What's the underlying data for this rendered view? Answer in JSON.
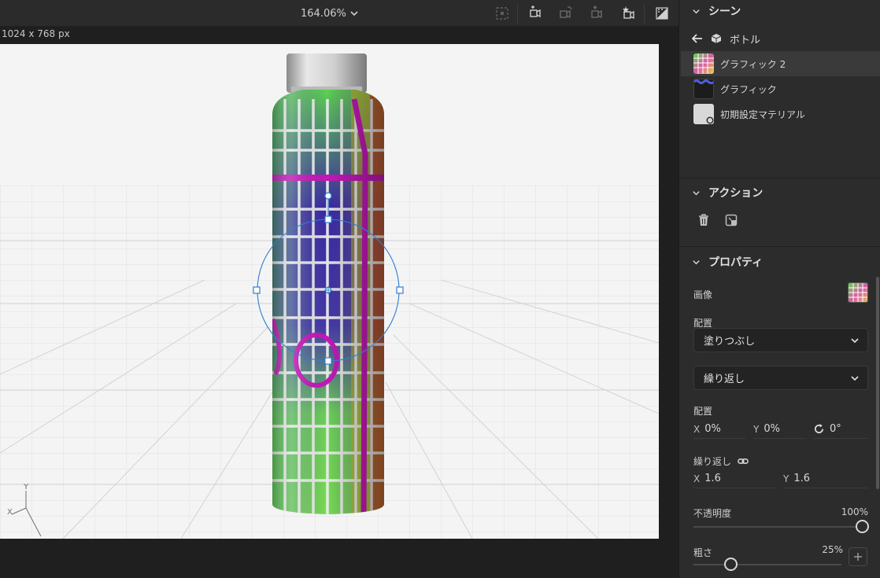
{
  "toolbar": {
    "zoom": "164.06%",
    "icons": [
      "frame-icon",
      "camera-bookmark-icon",
      "camera-rotate-icon",
      "camera-move-icon",
      "camera-favorite-icon",
      "render-preview-icon"
    ]
  },
  "viewport": {
    "size_label": "1024 x 768 px",
    "axis_y": "Y",
    "axis_x": "X"
  },
  "panel": {
    "scene": {
      "title": "シーン",
      "breadcrumb": "ボトル",
      "layers": [
        {
          "label": "グラフィック 2",
          "selected": true
        },
        {
          "label": "グラフィック",
          "selected": false
        },
        {
          "label": "初期設定マテリアル",
          "selected": false
        }
      ]
    },
    "actions": {
      "title": "アクション"
    },
    "properties": {
      "title": "プロパティ",
      "image_label": "画像",
      "placement_label": "配置",
      "fill_value": "塗りつぶし",
      "repeat_value": "繰り返し",
      "placement2_label": "配置",
      "x_label": "X",
      "x_value": "0%",
      "y_label": "Y",
      "y_value": "0%",
      "rotation_value": "0°",
      "tiling_label": "繰り返し",
      "tile_x_label": "X",
      "tile_x_value": "1.6",
      "tile_y_label": "Y",
      "tile_y_value": "1.6",
      "opacity_label": "不透明度",
      "opacity_value": "100%",
      "opacity_fraction": 1.0,
      "roughness_label": "粗さ",
      "roughness_value": "25%",
      "roughness_fraction": 0.25
    }
  },
  "colors": {
    "accent_magenta": "#c218b8",
    "gizmo_blue": "#2f7fd0",
    "panel_bg": "#2c2c2c"
  }
}
